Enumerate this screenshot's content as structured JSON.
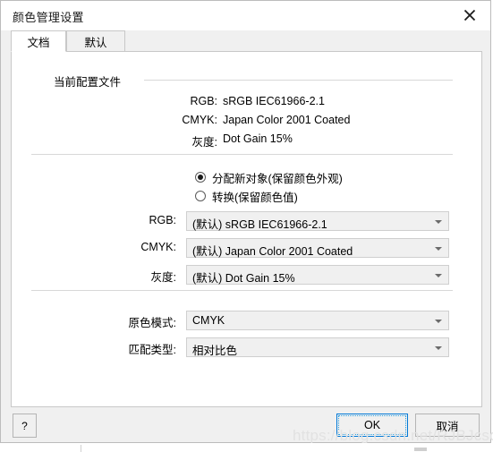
{
  "window": {
    "title": "颜色管理设置",
    "close_icon": "close-icon"
  },
  "tabs": [
    {
      "id": "doc",
      "label": "文档",
      "active": true
    },
    {
      "id": "def",
      "label": "默认",
      "active": false
    }
  ],
  "current_profiles": {
    "group_title": "当前配置文件",
    "rows": [
      {
        "label": "RGB:",
        "value": "sRGB IEC61966-2.1"
      },
      {
        "label": "CMYK:",
        "value": "Japan Color 2001 Coated"
      },
      {
        "label": "灰度:",
        "value": "Dot Gain 15%"
      }
    ]
  },
  "radios": [
    {
      "id": "assign",
      "label": "分配新对象(保留颜色外观)",
      "checked": true
    },
    {
      "id": "convert",
      "label": "转换(保留颜色值)",
      "checked": false
    }
  ],
  "profile_combos": [
    {
      "label": "RGB:",
      "value": "(默认) sRGB IEC61966-2.1"
    },
    {
      "label": "CMYK:",
      "value": "(默认) Japan Color 2001 Coated"
    },
    {
      "label": "灰度:",
      "value": "(默认) Dot Gain 15%"
    }
  ],
  "options": [
    {
      "label": "原色模式:",
      "value": "CMYK"
    },
    {
      "label": "匹配类型:",
      "value": "相对比色"
    }
  ],
  "footer": {
    "help_label": "?",
    "ok_label": "OK",
    "cancel_label": "取消"
  },
  "watermark": "https://blog.csdn.net/RJBJcsdn",
  "colors": {
    "accent": "#0078d7",
    "dialog_bg": "#f0f0f0",
    "panel_bg": "#ffffff",
    "border": "#c8c8c8"
  }
}
